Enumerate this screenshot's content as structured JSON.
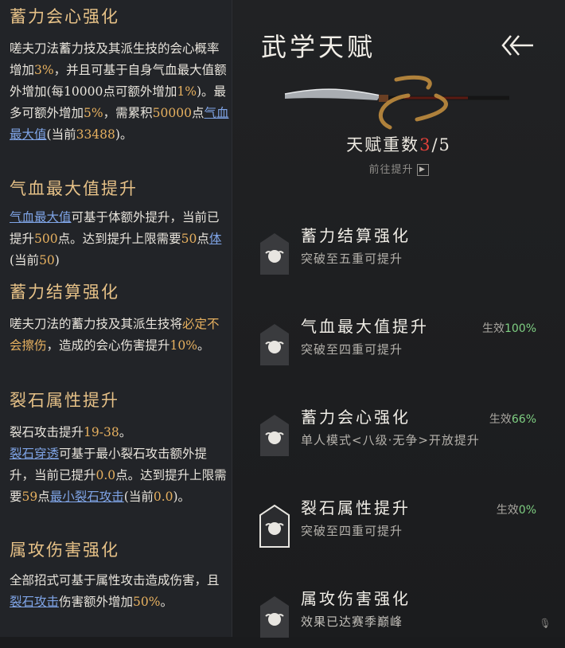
{
  "left": {
    "s1_title": "蓄力会心强化",
    "s1_a": "嗟夫刀法蓄力技及其派生技的会心概率增加",
    "s1_b": "3%",
    "s1_c": "，并且可基于自身气血最大值额外增加(每10000点可额外增加",
    "s1_d": "1%",
    "s1_e": ")。最多可额外增加",
    "s1_f": "5%",
    "s1_g": "，需累积",
    "s1_h": "50000",
    "s1_i": "点",
    "s1_j": "气血最大值",
    "s1_k": "(当前",
    "s1_l": "33488",
    "s1_m": ")。",
    "s2_title": "气血最大值提升",
    "s2_a": "气血最大值",
    "s2_b": "可基于体额外提升，当前已提升",
    "s2_c": "500",
    "s2_d": "点。达到提升上限需要",
    "s2_e": "50",
    "s2_f": "点",
    "s2_g": "体",
    "s2_h": "(当前",
    "s2_i": "50",
    "s2_j": ")",
    "s3_title": "蓄力结算强化",
    "s3_a": "嗟夫刀法的蓄力技及其派生技将",
    "s3_b": "必定不会擦伤",
    "s3_c": "，造成的会心伤害提升",
    "s3_d": "10%",
    "s3_e": "。",
    "s4_title": "裂石属性提升",
    "s4_a": "裂石攻击提升",
    "s4_b": "19-38",
    "s4_c": "。",
    "s4_d": "裂石穿透",
    "s4_e": "可基于最小裂石攻击额外提升，当前已提升",
    "s4_f": "0.0",
    "s4_g": "点。达到提升上限需要",
    "s4_h": "59",
    "s4_i": "点",
    "s4_j": "最小裂石攻击",
    "s4_k": "(当前",
    "s4_l": "0.0",
    "s4_m": ")。",
    "s5_title": "属攻伤害强化",
    "s5_a": "全部招式可基于属性攻击造成伤害，且",
    "s5_b": "裂石攻击",
    "s5_c": "伤害额外增加",
    "s5_d": "50%",
    "s5_e": "。"
  },
  "right": {
    "title": "武学天赋",
    "back_icon": "double-chevron-left-icon",
    "count_label": "天赋重数",
    "count_current": "3",
    "count_total": "/5",
    "goto_label": "前往提升",
    "items": [
      {
        "name": "蓄力结算强化",
        "sub": "突破至五重可提升",
        "stat_label": "",
        "stat_value": ""
      },
      {
        "name": "气血最大值提升",
        "sub": "突破至四重可提升",
        "stat_label": "生效",
        "stat_value": "100%"
      },
      {
        "name": "蓄力会心强化",
        "sub": "单人模式<八级·无争>开放提升",
        "stat_label": "生效",
        "stat_value": "66%"
      },
      {
        "name": "裂石属性提升",
        "sub": "突破至四重可提升",
        "stat_label": "生效",
        "stat_value": "0%"
      },
      {
        "name": "属攻伤害强化",
        "sub": "效果已达赛季巅峰",
        "stat_label": "",
        "stat_value": ""
      }
    ]
  },
  "colors": {
    "accent_gold": "#e6c187",
    "highlight": "#e6b05f",
    "link": "#7fa4e6",
    "count_red": "#e2413a",
    "effect_green": "#7fcf82"
  }
}
